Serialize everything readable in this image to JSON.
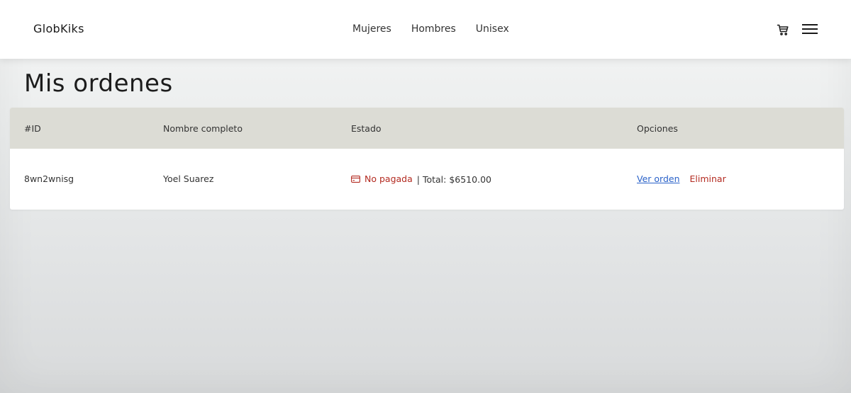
{
  "header": {
    "brand": "GlobKiks",
    "nav": [
      {
        "label": "Mujeres"
      },
      {
        "label": "Hombres"
      },
      {
        "label": "Unisex"
      }
    ]
  },
  "page": {
    "title": "Mis ordenes"
  },
  "orders_table": {
    "columns": [
      "#ID",
      "Nombre completo",
      "Estado",
      "Opciones"
    ],
    "rows": [
      {
        "id": "8wn2wnisg",
        "name": "Yoel Suarez",
        "status": "No pagada",
        "total_text": "| Total: $6510.00",
        "view_label": "Ver orden",
        "delete_label": "Eliminar"
      }
    ]
  },
  "colors": {
    "header_bg": "#ffffff",
    "table_head_bg": "#dcdcd5",
    "status_unpaid": "#b32a20",
    "link_blue": "#2a62c9"
  },
  "icons": {
    "cart": "cart-icon",
    "menu": "hamburger-menu-icon",
    "status": "credit-card-icon"
  }
}
